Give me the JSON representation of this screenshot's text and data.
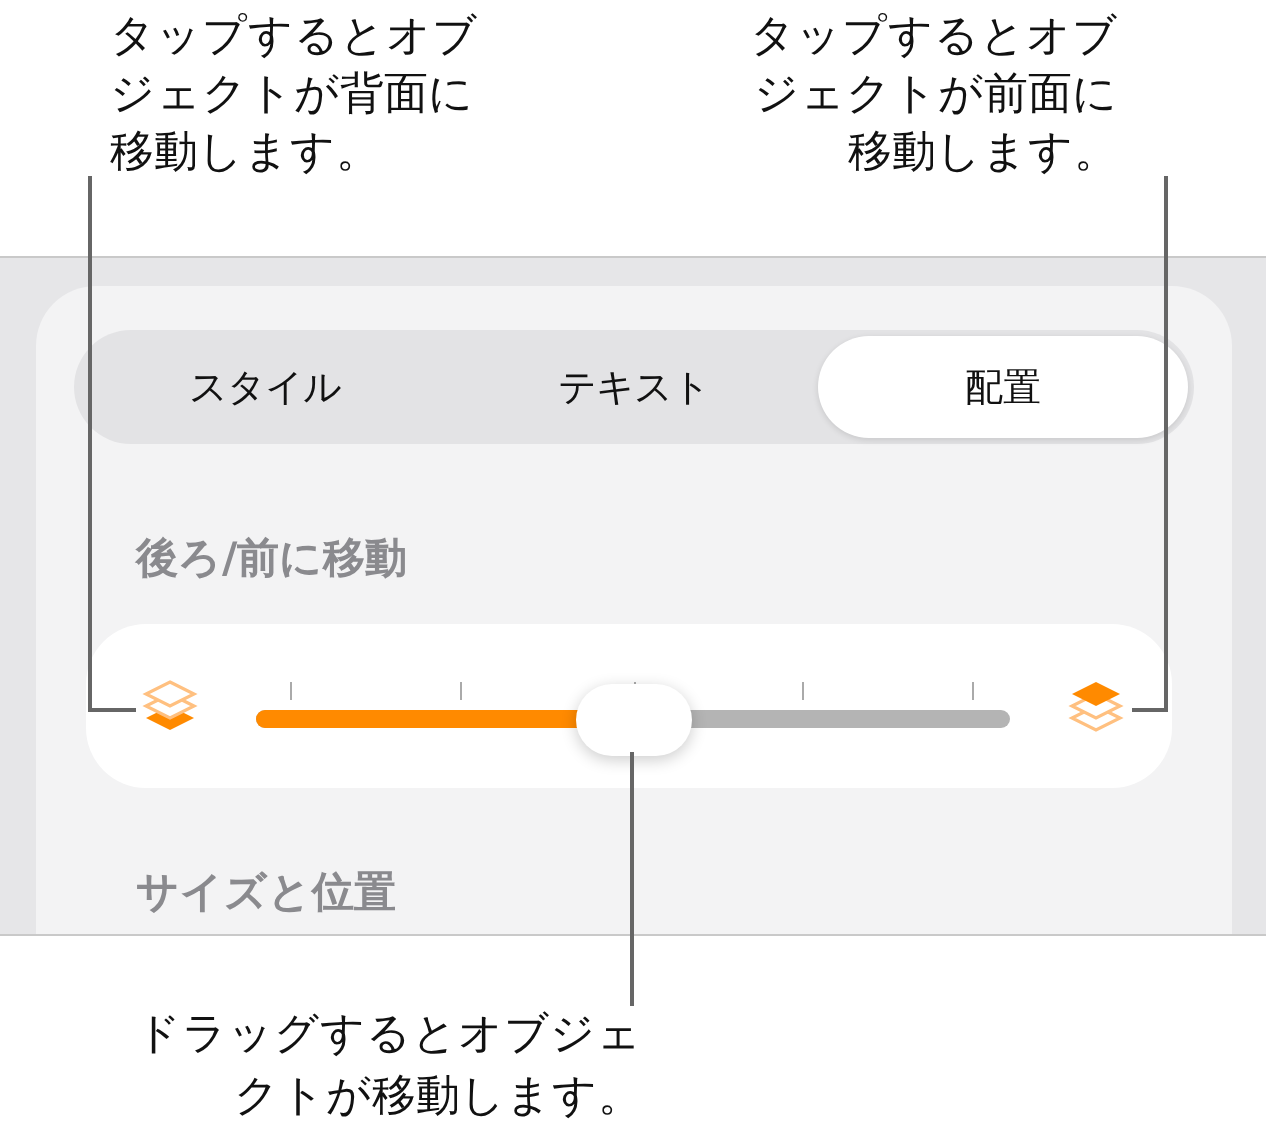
{
  "callouts_top": [
    {
      "text": "タップするとオブジェクトが背面に移動します。"
    },
    {
      "text": "タップするとオブジェクトが前面に移動します。"
    }
  ],
  "tabs": [
    {
      "label": "スタイル",
      "selected": false
    },
    {
      "label": "テキスト",
      "selected": false
    },
    {
      "label": "配置",
      "selected": true
    }
  ],
  "arrange_section": {
    "heading": "後ろ/前に移動",
    "slider": {
      "level": 0.5
    }
  },
  "size_section": {
    "heading": "サイズと位置"
  },
  "callout_bottom": {
    "text": "ドラッグするとオブジェクトが移動します。"
  }
}
